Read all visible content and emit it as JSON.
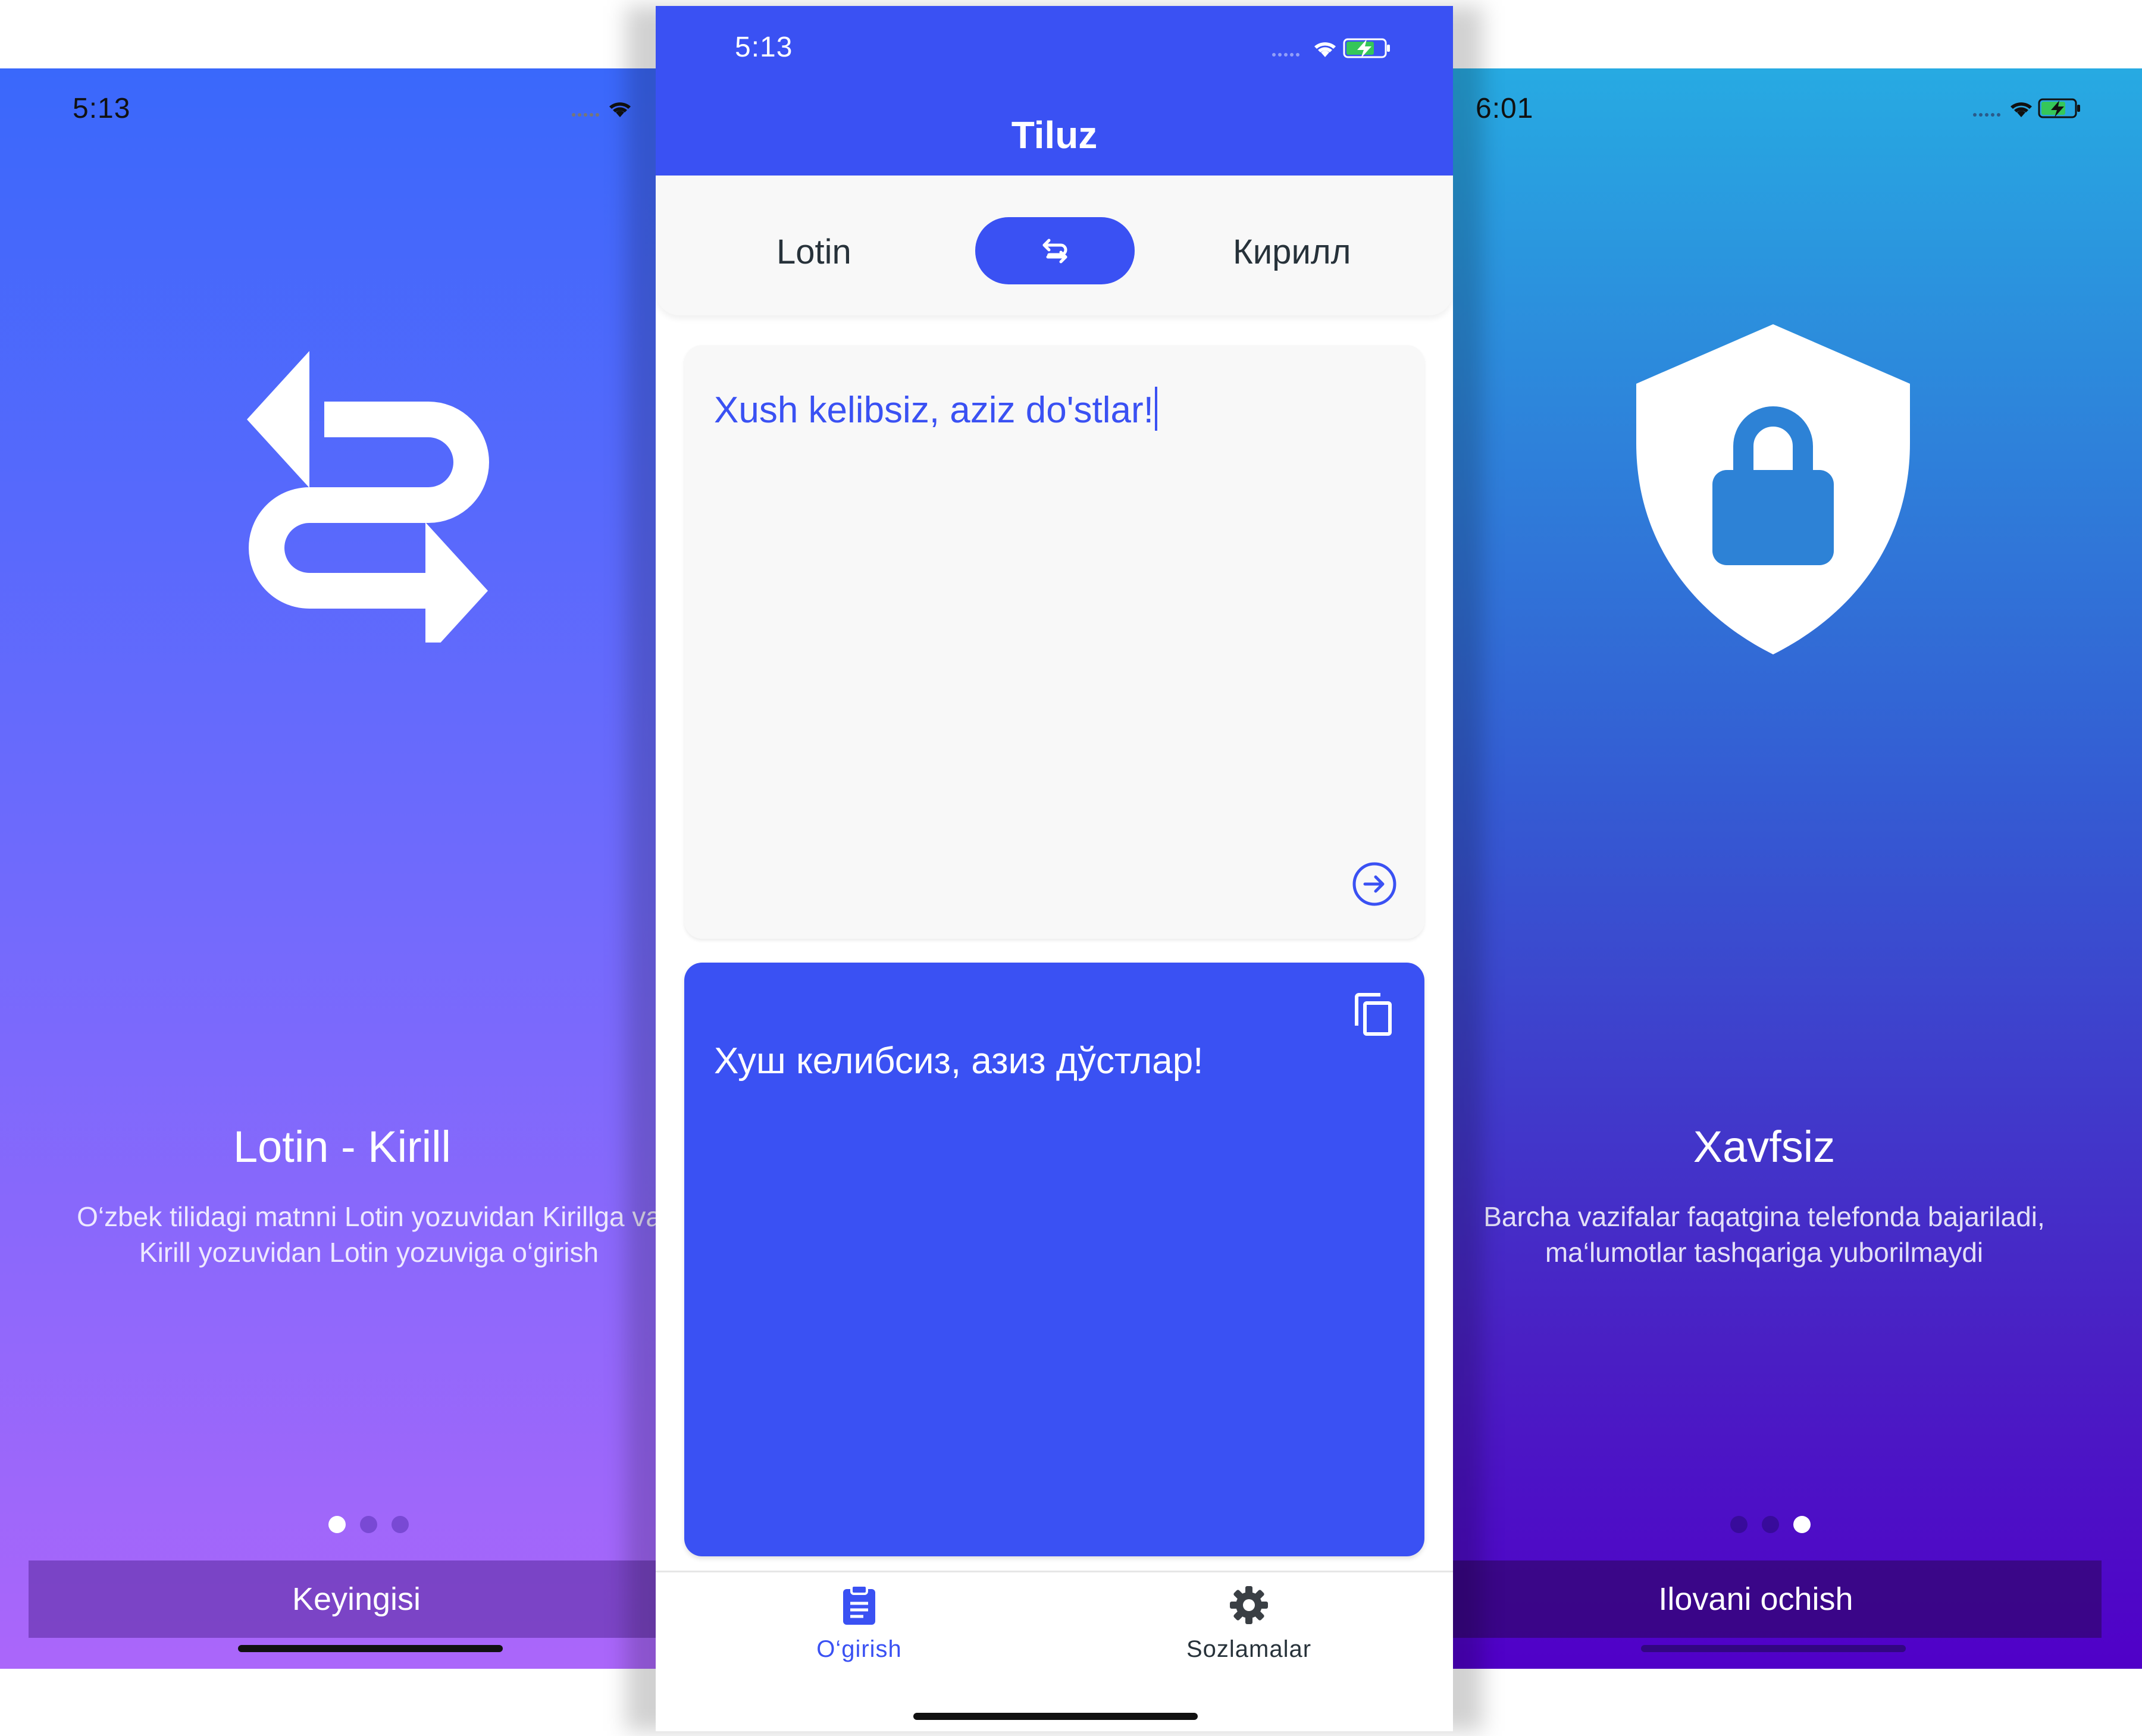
{
  "left_screen": {
    "status_time": "5:13",
    "title": "Lotin - Kirill",
    "description_line1": "O‘zbek tilidagi matnni Lotin yozuvidan Kirillga va",
    "description_line2": "Kirill yozuvidan Lotin yozuviga o‘girish",
    "page_index": 1,
    "page_count": 3,
    "button_label": "Keyingisi",
    "icon": "swap-arrows-icon"
  },
  "center_screen": {
    "status_time": "5:13",
    "app_title": "Tiluz",
    "source_language": "Lotin",
    "target_language": "Кирилл",
    "input_text": "Xush kelibsiz, aziz do'stlar!",
    "output_text": "Хуш келибсиз, азиз дўстлар!",
    "tabs": [
      {
        "label": "O‘girish",
        "icon": "clipboard-icon",
        "active": true
      },
      {
        "label": "Sozlamalar",
        "icon": "gear-icon",
        "active": false
      }
    ],
    "colors": {
      "primary": "#3a51f3",
      "text_dark": "#27323a",
      "card_bg": "#f8f8f8"
    }
  },
  "right_screen": {
    "status_time": "6:01",
    "title": "Xavfsiz",
    "description_line1": "Barcha vazifalar faqatgina telefonda bajariladi,",
    "description_line2": "ma‘lumotlar tashqariga yuborilmaydi",
    "page_index": 3,
    "page_count": 3,
    "button_label": "Ilovani ochish",
    "icon": "shield-lock-icon"
  }
}
